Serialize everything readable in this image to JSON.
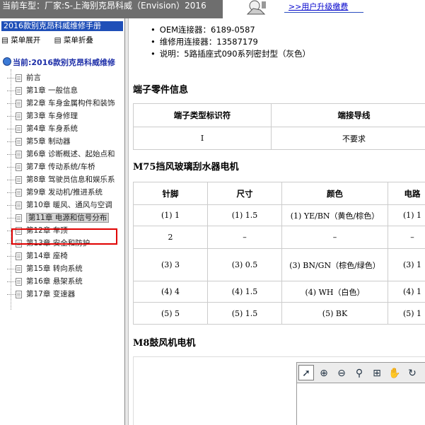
{
  "header": {
    "current_model_label": "当前车型：",
    "current_model_value": "厂家:S-上海别克昂科威（Envision）2016",
    "upgrade_link": ">>用户升级缴费"
  },
  "sidebar": {
    "manual_title": "2016款别克昂科威维修手册",
    "expand_label": "菜单展开",
    "collapse_label": "菜单折叠",
    "current_label": "当前:2016款别克昂科威维修",
    "items": [
      {
        "label": "前言"
      },
      {
        "label": "第1章 一般信息"
      },
      {
        "label": "第2章 车身金属构件和装饰"
      },
      {
        "label": "第3章 车身修理"
      },
      {
        "label": "第4章 车身系统"
      },
      {
        "label": "第5章 制动器"
      },
      {
        "label": "第6章 诊断概述、起始点和"
      },
      {
        "label": "第7章 传动系统/车桥"
      },
      {
        "label": "第8章 驾驶员信息和娱乐系"
      },
      {
        "label": "第9章 发动机/推进系统"
      },
      {
        "label": "第10章 暖风、通风与空调"
      },
      {
        "label": "第11章 电源和信号分布"
      },
      {
        "label": "第12章 车顶"
      },
      {
        "label": "第13章 安全和防护"
      },
      {
        "label": "第14章 座椅"
      },
      {
        "label": "第15章 转向系统"
      },
      {
        "label": "第16章 悬架系统"
      },
      {
        "label": "第17章 变速器"
      }
    ]
  },
  "content": {
    "bullets": [
      "OEM连接器：6189-0587",
      "维修用连接器：13587179",
      "说明：5路插座式090系列密封型（灰色）"
    ],
    "terminal_heading": "端子零件信息",
    "terminal_table": {
      "headers": [
        "端子类型标识符",
        "端接导线"
      ],
      "rows": [
        [
          "I",
          "不要求"
        ]
      ]
    },
    "m75_heading": "M75挡风玻璃刮水器电机",
    "m75_table": {
      "headers": [
        "针脚",
        "尺寸",
        "颜色",
        "电路"
      ],
      "rows": [
        [
          "(1) 1",
          "(1) 1.5",
          "(1) YE/BN（黄色/棕色）",
          "(1) 1"
        ],
        [
          "2",
          "–",
          "–",
          "–"
        ],
        [
          "(3) 3",
          "(3) 0.5",
          "(3) BN/GN（棕色/绿色）",
          "(3) 1"
        ],
        [
          "(4) 4",
          "(4) 1.5",
          "(4) WH（白色）",
          "(4) 1"
        ],
        [
          "(5) 5",
          "(5) 1.5",
          "(5) BK",
          "(5) 1"
        ]
      ]
    },
    "m8_heading": "M8鼓风机电机"
  }
}
